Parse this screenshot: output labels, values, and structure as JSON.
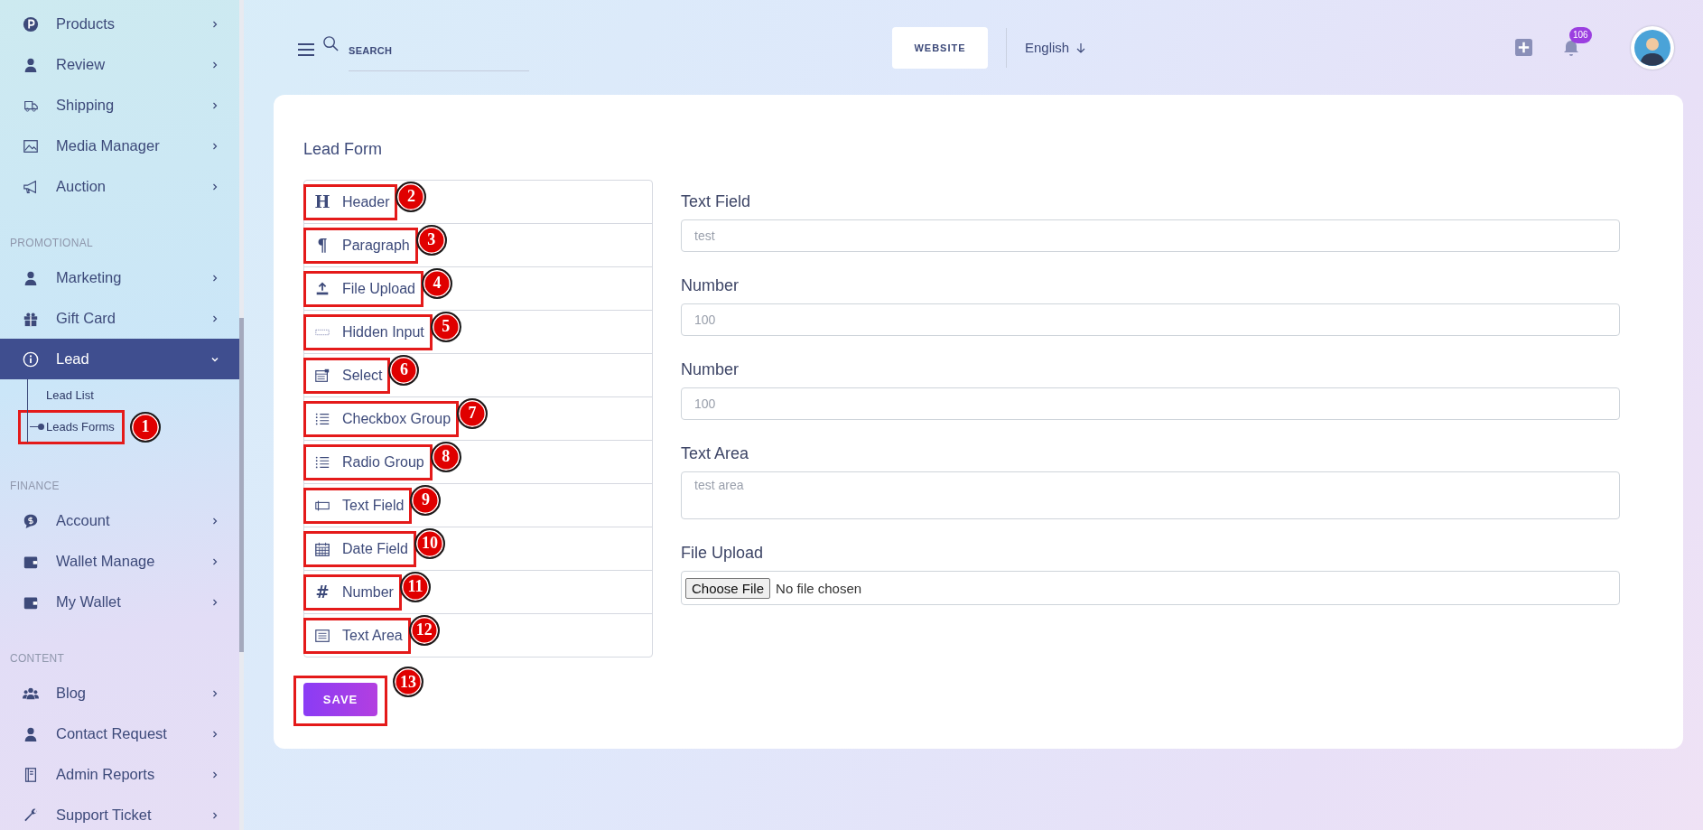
{
  "sidebar": {
    "sections": [
      {
        "items": [
          {
            "label": "Products",
            "selected": false,
            "expanded": false
          },
          {
            "label": "Review",
            "selected": false,
            "expanded": false
          },
          {
            "label": "Shipping",
            "selected": false,
            "expanded": false
          },
          {
            "label": "Media Manager",
            "selected": false,
            "expanded": false
          },
          {
            "label": "Auction",
            "selected": false,
            "expanded": false
          }
        ]
      },
      {
        "heading": "PROMOTIONAL",
        "items": [
          {
            "label": "Marketing",
            "selected": false,
            "expanded": false
          },
          {
            "label": "Gift Card",
            "selected": false,
            "expanded": false
          },
          {
            "label": "Lead",
            "selected": true,
            "expanded": true,
            "children": [
              {
                "label": "Lead List",
                "selected": false
              },
              {
                "label": "Leads Forms",
                "selected": true,
                "annotation": "1"
              }
            ]
          }
        ]
      },
      {
        "heading": "FINANCE",
        "items": [
          {
            "label": "Account",
            "selected": false,
            "expanded": false
          },
          {
            "label": "Wallet Manage",
            "selected": false,
            "expanded": false
          },
          {
            "label": "My Wallet",
            "selected": false,
            "expanded": false
          }
        ]
      },
      {
        "heading": "CONTENT",
        "items": [
          {
            "label": "Blog",
            "selected": false,
            "expanded": false
          },
          {
            "label": "Contact Request",
            "selected": false,
            "expanded": false
          },
          {
            "label": "Admin Reports",
            "selected": false,
            "expanded": false
          },
          {
            "label": "Support Ticket",
            "selected": false,
            "expanded": false
          }
        ]
      }
    ]
  },
  "topbar": {
    "search": {
      "placeholder": "SEARCH"
    },
    "website_button": "WEBSITE",
    "language": "English",
    "notification_count": "106"
  },
  "form": {
    "title": "Lead Form",
    "palette": [
      {
        "glyph": "H",
        "label": "Header",
        "annotation": "2"
      },
      {
        "glyph": "¶",
        "label": "Paragraph",
        "annotation": "3"
      },
      {
        "label": "File Upload",
        "annotation": "4"
      },
      {
        "label": "Hidden Input",
        "annotation": "5"
      },
      {
        "label": "Select",
        "annotation": "6"
      },
      {
        "label": "Checkbox Group",
        "annotation": "7"
      },
      {
        "label": "Radio Group",
        "annotation": "8"
      },
      {
        "label": "Text Field",
        "annotation": "9"
      },
      {
        "label": "Date Field",
        "annotation": "10"
      },
      {
        "glyph": "#",
        "label": "Number",
        "annotation": "11"
      },
      {
        "label": "Text Area",
        "annotation": "12"
      }
    ],
    "fields": [
      {
        "kind": "text",
        "label": "Text Field",
        "placeholder": "test"
      },
      {
        "kind": "number",
        "label": "Number",
        "placeholder": "100"
      },
      {
        "kind": "number",
        "label": "Number",
        "placeholder": "100"
      },
      {
        "kind": "textarea",
        "label": "Text Area",
        "placeholder": "test area"
      },
      {
        "kind": "file",
        "label": "File Upload",
        "button": "Choose File",
        "status": "No file chosen"
      }
    ],
    "save": {
      "label": "SAVE",
      "annotation": "13"
    }
  }
}
